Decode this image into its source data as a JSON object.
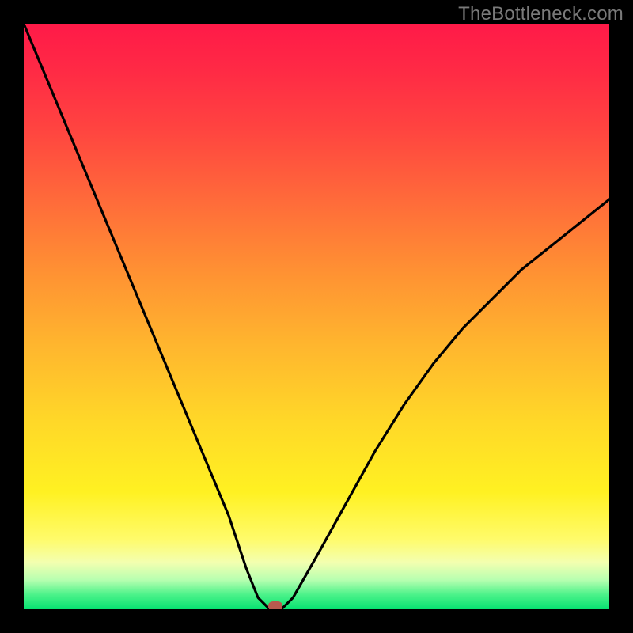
{
  "watermark": "TheBottleneck.com",
  "colors": {
    "frame_bg": "#000000",
    "curve_stroke": "#000000",
    "marker_fill": "#b85a4e",
    "gradient_top": "#ff1a48",
    "gradient_bottom": "#07e271"
  },
  "chart_data": {
    "type": "line",
    "title": "",
    "xlabel": "",
    "ylabel": "",
    "xlim": [
      0,
      100
    ],
    "ylim": [
      0,
      100
    ],
    "x": [
      0,
      5,
      10,
      15,
      20,
      25,
      30,
      35,
      38,
      40,
      42,
      44,
      46,
      50,
      55,
      60,
      65,
      70,
      75,
      80,
      85,
      90,
      95,
      100
    ],
    "values": [
      100,
      88,
      76,
      64,
      52,
      40,
      28,
      16,
      7,
      2,
      0,
      0,
      2,
      9,
      18,
      27,
      35,
      42,
      48,
      53,
      58,
      62,
      66,
      70
    ],
    "marker": {
      "x": 43,
      "y": 0
    },
    "notes": "Curve drops from top-left to a near-zero minimum around x≈41–44, then rises toward x=100 reaching roughly 70% height. Y-axis values estimated from vertical position (0=bottom, 100=top)."
  }
}
